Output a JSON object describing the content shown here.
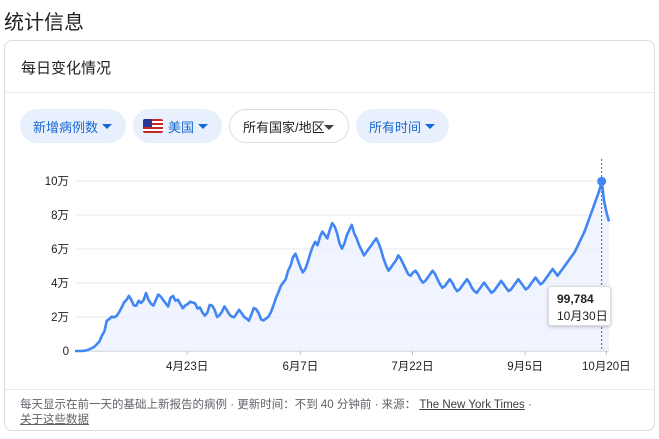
{
  "page": {
    "title": "统计信息"
  },
  "card": {
    "title": "每日变化情况"
  },
  "filters": {
    "metric": "新增病例数",
    "location": "美国",
    "scope": "所有国家/地区",
    "time": "所有时间"
  },
  "tooltip": {
    "value": "99,784",
    "date": "10月30日"
  },
  "footer": {
    "prefix": "每天显示在前一天的基础上新报告的病例 · 更新时间：",
    "updated": "不到 40 分钟前",
    "source_label": " · 来源：",
    "source": "The New York Times",
    "sep": " ·",
    "about": "关于这些数据"
  },
  "colors": {
    "line": "#4285f4",
    "area": "#e8f0fe",
    "chip_blue_bg": "#e8f0fe",
    "chip_blue_text": "#1967d2"
  },
  "chart_data": {
    "type": "area",
    "series": [
      {
        "values": [
          10,
          16,
          29,
          56,
          200,
          448,
          1044,
          1789,
          2619,
          4098,
          5710,
          9089,
          11532,
          17812,
          18839,
          20193,
          19845,
          20584,
          22847,
          25433,
          28617,
          30006,
          32418,
          30131,
          26889,
          26561,
          29578,
          28321,
          29913,
          34139,
          30101,
          27896,
          26713,
          30018,
          33162,
          32077,
          30027,
          28126,
          26187,
          31256,
          32403,
          29601,
          30152,
          27631,
          25091,
          26781,
          27632,
          29008,
          28531,
          28097,
          25012,
          25567,
          22689,
          20829,
          22521,
          27082,
          26734,
          24256,
          19994,
          21031,
          23185,
          26231,
          24013,
          21548,
          20215,
          19876,
          22116,
          24234,
          22321,
          20143,
          19127,
          17827,
          21543,
          25276,
          24521,
          22124,
          18534,
          18021,
          19134,
          20234,
          22931,
          26821,
          31121,
          34432,
          38214,
          40213,
          42123,
          47213,
          50213,
          55213,
          57213,
          53213,
          49213,
          46213,
          48213,
          52213,
          57213,
          61213,
          64213,
          62213,
          67213,
          70213,
          68213,
          66213,
          71213,
          75213,
          73213,
          69213,
          63213,
          60213,
          63213,
          68213,
          71213,
          74213,
          69213,
          66213,
          62213,
          59213,
          56213,
          58213,
          60213,
          62213,
          64213,
          66213,
          63213,
          59213,
          54213,
          50213,
          47213,
          49213,
          51213,
          53213,
          56213,
          54213,
          51213,
          48213,
          45213,
          44213,
          46213,
          47213,
          45213,
          42213,
          40213,
          41213,
          43213,
          45213,
          47213,
          45213,
          42213,
          39213,
          37213,
          38213,
          40213,
          42213,
          40213,
          37213,
          35213,
          36213,
          38213,
          40213,
          42213,
          40213,
          37213,
          35213,
          34213,
          36213,
          38213,
          40213,
          38213,
          36213,
          34213,
          35213,
          37213,
          39213,
          41213,
          39213,
          37213,
          35213,
          36213,
          38213,
          40213,
          42213,
          40213,
          38213,
          36213,
          37213,
          39213,
          41213,
          43213,
          41213,
          39213,
          40213,
          42213,
          44213,
          46213,
          48213,
          46213,
          44213,
          46213,
          48213,
          50213,
          52213,
          54213,
          56213,
          58213,
          61213,
          64213,
          67213,
          70213,
          74213,
          78213,
          82213,
          86213,
          90213,
          94213,
          99784,
          88213,
          81213,
          76213
        ]
      }
    ],
    "x_ticks": [
      "4月23日",
      "6月7日",
      "7月22日",
      "9月5日",
      "10月20日"
    ],
    "y_ticks": [
      "0",
      "2万",
      "4万",
      "6万",
      "8万",
      "10万"
    ],
    "ylim": [
      0,
      100000
    ],
    "grid": true,
    "highlight": {
      "label": "10月30日",
      "value": 99784
    }
  }
}
